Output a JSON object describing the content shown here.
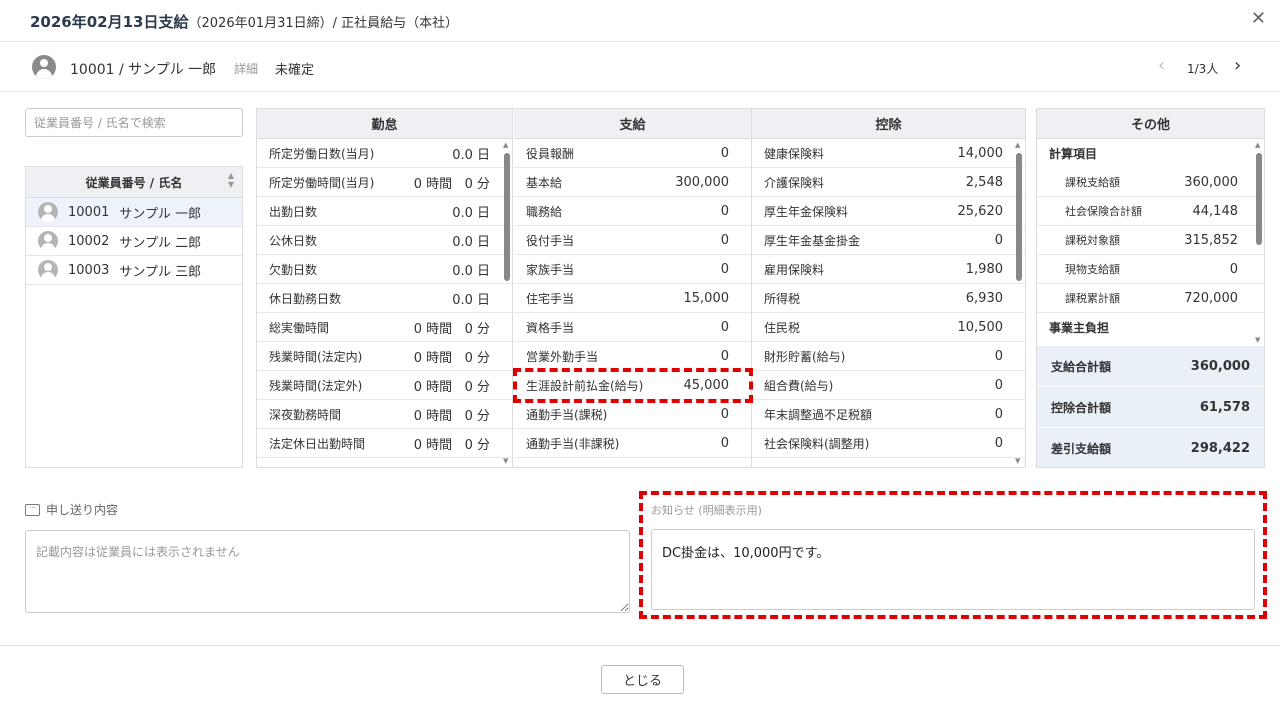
{
  "header": {
    "title": "2026年02月13日支給",
    "subtitle": "（2026年01月31日締）/ 正社員給与（本社）",
    "close": "✕"
  },
  "employee": {
    "name": "10001 / サンプル 一郎",
    "detail": "詳細",
    "status": "未確定",
    "pager": "1/3人",
    "prev": "‹",
    "next": "›"
  },
  "search": {
    "placeholder": "従業員番号 / 氏名で検索"
  },
  "employee_list": {
    "header": "従業員番号 / 氏名",
    "items": [
      {
        "id": "10001",
        "name": "サンプル 一郎"
      },
      {
        "id": "10002",
        "name": "サンプル 二郎"
      },
      {
        "id": "10003",
        "name": "サンプル 三郎"
      }
    ]
  },
  "attendance": {
    "title": "勤怠",
    "rows": [
      [
        "所定労働日数(当月)",
        "0.0 日"
      ],
      [
        "所定労働時間(当月)",
        "0 時間   0 分"
      ],
      [
        "出勤日数",
        "0.0 日"
      ],
      [
        "公休日数",
        "0.0 日"
      ],
      [
        "欠勤日数",
        "0.0 日"
      ],
      [
        "休日勤務日数",
        "0.0 日"
      ],
      [
        "総実働時間",
        "0 時間   0 分"
      ],
      [
        "残業時間(法定内)",
        "0 時間   0 分"
      ],
      [
        "残業時間(法定外)",
        "0 時間   0 分"
      ],
      [
        "深夜勤務時間",
        "0 時間   0 分"
      ],
      [
        "法定休日出勤時間",
        "0 時間   0 分"
      ]
    ]
  },
  "payment": {
    "title": "支給",
    "rows": [
      [
        "役員報酬",
        "0"
      ],
      [
        "基本給",
        "300,000"
      ],
      [
        "職務給",
        "0"
      ],
      [
        "役付手当",
        "0"
      ],
      [
        "家族手当",
        "0"
      ],
      [
        "住宅手当",
        "15,000"
      ],
      [
        "資格手当",
        "0"
      ],
      [
        "営業外勤手当",
        "0"
      ],
      [
        "生涯設計前払金(給与)",
        "45,000"
      ],
      [
        "通勤手当(課税)",
        "0"
      ],
      [
        "通勤手当(非課税)",
        "0"
      ]
    ]
  },
  "deduction": {
    "title": "控除",
    "rows": [
      [
        "健康保険料",
        "14,000"
      ],
      [
        "介護保険料",
        "2,548"
      ],
      [
        "厚生年金保険料",
        "25,620"
      ],
      [
        "厚生年金基金掛金",
        "0"
      ],
      [
        "雇用保険料",
        "1,980"
      ],
      [
        "所得税",
        "6,930"
      ],
      [
        "住民税",
        "10,500"
      ],
      [
        "財形貯蓄(給与)",
        "0"
      ],
      [
        "組合費(給与)",
        "0"
      ],
      [
        "年末調整過不足税額",
        "0"
      ],
      [
        "社会保険料(調整用)",
        "0"
      ]
    ]
  },
  "other": {
    "title": "その他",
    "section1": "計算項目",
    "rows": [
      [
        "課税支給額",
        "360,000"
      ],
      [
        "社会保険合計額",
        "44,148"
      ],
      [
        "課税対象額",
        "315,852"
      ],
      [
        "現物支給額",
        "0"
      ],
      [
        "課税累計額",
        "720,000"
      ]
    ],
    "section2": "事業主負担",
    "totals": [
      [
        "支給合計額",
        "360,000"
      ],
      [
        "控除合計額",
        "61,578"
      ],
      [
        "差引支給額",
        "298,422"
      ]
    ]
  },
  "memo": {
    "label": "申し送り内容",
    "placeholder": "記載内容は従業員には表示されません"
  },
  "notice": {
    "label": "お知らせ (明細表示用)",
    "value": "DC掛金は、10,000円です。"
  },
  "footer": {
    "close_button": "とじる"
  },
  "colors": {
    "highlight": "#e00000",
    "accent_bg": "#eaf0f8"
  }
}
